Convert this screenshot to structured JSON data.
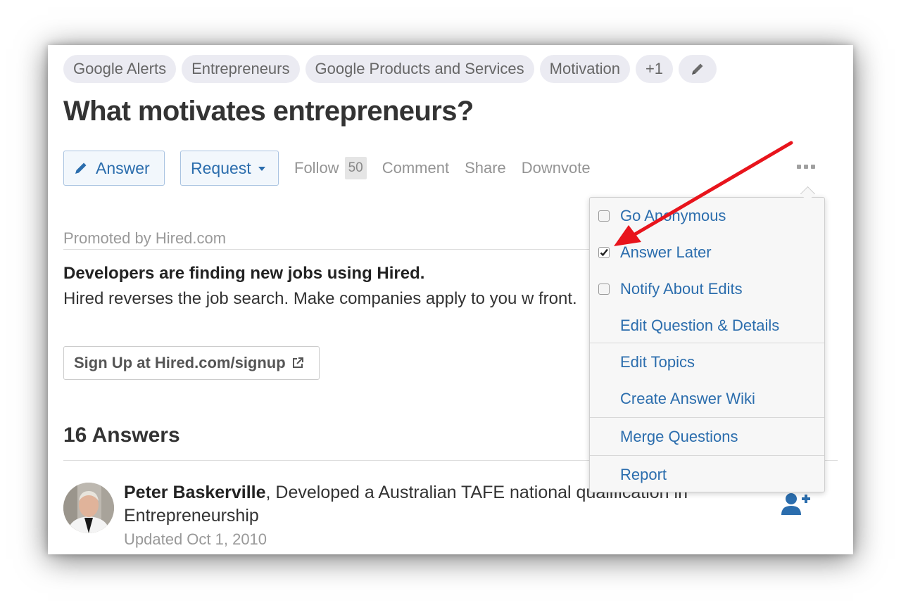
{
  "topics": [
    "Google Alerts",
    "Entrepreneurs",
    "Google Products and Services",
    "Motivation",
    "+1"
  ],
  "question": {
    "title": "What motivates entrepreneurs?"
  },
  "actions": {
    "answer": "Answer",
    "request": "Request",
    "follow": "Follow",
    "follow_count": "50",
    "comment": "Comment",
    "share": "Share",
    "downvote": "Downvote"
  },
  "promo": {
    "label": "Promoted by Hired.com",
    "headline": "Developers are finding new jobs using Hired.",
    "body": "Hired reverses the job search. Make companies apply to you w front.",
    "cta": "Sign Up at Hired.com/signup"
  },
  "answers": {
    "count_label": "16 Answers",
    "first": {
      "author": "Peter Baskerville",
      "credential": ", Developed a Australian TAFE national qualification in Entrepreneurship",
      "updated": "Updated Oct 1, 2010"
    }
  },
  "menu": {
    "items": [
      {
        "label": "Go Anonymous",
        "checkbox": true,
        "checked": false
      },
      {
        "label": "Answer Later",
        "checkbox": true,
        "checked": true
      },
      {
        "label": "Notify About Edits",
        "checkbox": true,
        "checked": false
      },
      {
        "label": "Edit Question & Details"
      },
      {
        "label": "Edit Topics"
      },
      {
        "label": "Create Answer Wiki"
      },
      {
        "label": "Merge Questions"
      },
      {
        "label": "Report"
      }
    ]
  },
  "colors": {
    "link": "#2b6dad",
    "annotation_arrow": "#e8141c",
    "topic_bg": "#ebebf2"
  },
  "icons": [
    "pencil-icon",
    "caret-down-icon",
    "more-dots-icon",
    "external-link-icon",
    "add-user-icon",
    "checkbox-icon"
  ]
}
